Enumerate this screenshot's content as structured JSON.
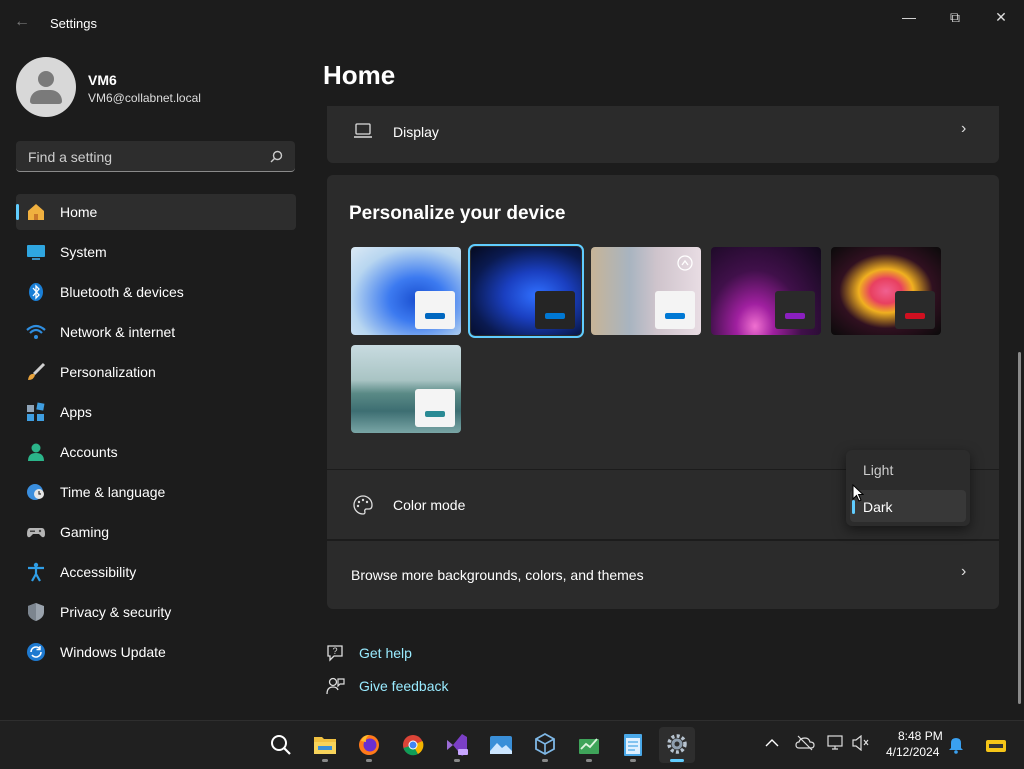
{
  "window": {
    "title": "Settings"
  },
  "user": {
    "name": "VM6",
    "email": "VM6@collabnet.local"
  },
  "search": {
    "placeholder": "Find a setting"
  },
  "nav": [
    {
      "label": "Home",
      "icon": "home-icon",
      "active": true
    },
    {
      "label": "System",
      "icon": "system-icon"
    },
    {
      "label": "Bluetooth & devices",
      "icon": "bluetooth-icon"
    },
    {
      "label": "Network & internet",
      "icon": "wifi-icon"
    },
    {
      "label": "Personalization",
      "icon": "brush-icon"
    },
    {
      "label": "Apps",
      "icon": "apps-icon"
    },
    {
      "label": "Accounts",
      "icon": "accounts-icon"
    },
    {
      "label": "Time & language",
      "icon": "clock-globe-icon"
    },
    {
      "label": "Gaming",
      "icon": "gamepad-icon"
    },
    {
      "label": "Accessibility",
      "icon": "accessibility-icon"
    },
    {
      "label": "Privacy & security",
      "icon": "shield-icon"
    },
    {
      "label": "Windows Update",
      "icon": "update-icon"
    }
  ],
  "page": {
    "title": "Home"
  },
  "display_row": {
    "label": "Display"
  },
  "personalize": {
    "title": "Personalize your device",
    "themes": [
      "light-bloom",
      "dark-bloom",
      "captured-motion",
      "glow",
      "flow",
      "sunrise"
    ],
    "selected_theme": "dark-bloom"
  },
  "color_mode": {
    "label": "Color mode",
    "options": [
      "Light",
      "Dark"
    ],
    "selected": "Dark"
  },
  "browse": {
    "label": "Browse more backgrounds, colors, and themes"
  },
  "links": {
    "help": "Get help",
    "feedback": "Give feedback"
  },
  "taskbar": {
    "apps": [
      "search-icon",
      "file-explorer-icon",
      "firefox-icon",
      "chrome-icon",
      "visual-studio-icon",
      "photos-icon",
      "virtualbox-icon",
      "task-manager-icon",
      "notepad-icon",
      "settings-icon"
    ],
    "active_app": "settings-icon",
    "time": "8:48 PM",
    "date": "4/12/2024"
  },
  "colors": {
    "accent": "#60cdff",
    "background": "#1c1c1c",
    "card": "#2b2b2b"
  }
}
